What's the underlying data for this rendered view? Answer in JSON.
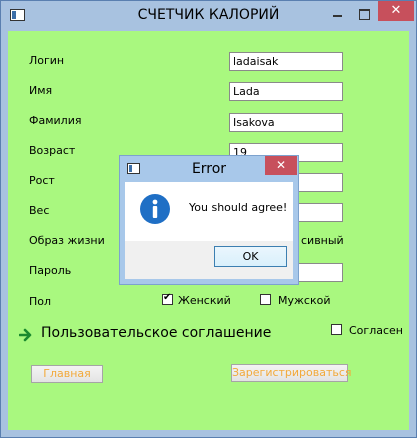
{
  "window": {
    "title": "СЧЕТЧИК КАЛОРИЙ",
    "close_glyph": "✕"
  },
  "form": {
    "login_label": "Логин",
    "login_value": "ladaisak",
    "name_label": "Имя",
    "name_value": "Lada",
    "surname_label": "Фамилия",
    "surname_value": "Isakova",
    "age_label": "Возраст",
    "age_value": "19",
    "height_label": "Рост",
    "height_value": "",
    "weight_label": "Вес",
    "weight_value": "",
    "lifestyle_label": "Образ жизни",
    "lifestyle_value_partial": "сивный",
    "password_label": "Пароль",
    "password_value": "",
    "gender_label": "Пол",
    "gender_female": "Женский",
    "gender_male": "Мужской",
    "gender_female_checked": true,
    "gender_male_checked": false,
    "agreement_link": "Пользовательское соглашение",
    "agree_label": "Согласен",
    "agree_checked": false
  },
  "buttons": {
    "home": "Главная",
    "register": "Зарегистрироваться"
  },
  "dialog": {
    "title": "Error",
    "close_glyph": "✕",
    "message": "You should agree!",
    "ok": "OK",
    "icon": "info-icon"
  },
  "colors": {
    "client_bg": "#a9f87f",
    "button_text": "#f2a93b",
    "title_close": "#c7505c"
  }
}
